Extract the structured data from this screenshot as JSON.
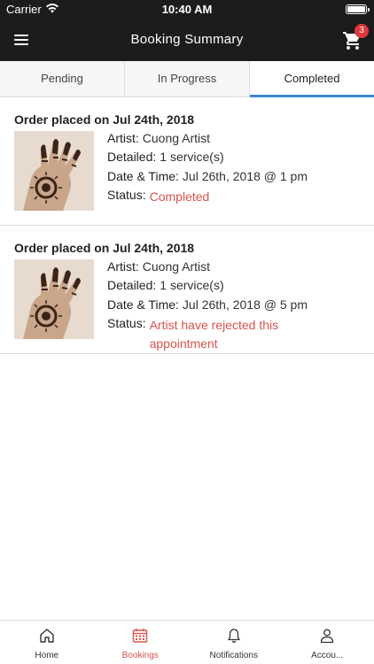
{
  "status_bar": {
    "carrier": "Carrier",
    "time": "10:40 AM"
  },
  "nav": {
    "title": "Booking Summary",
    "cart_count": "3"
  },
  "tabs": [
    {
      "label": "Pending",
      "active": false
    },
    {
      "label": "In Progress",
      "active": false
    },
    {
      "label": "Completed",
      "active": true
    }
  ],
  "orders": [
    {
      "heading": "Order placed on Jul 24th, 2018",
      "artist_label": "Artist:",
      "artist": "Cuong Artist",
      "detailed_label": "Detailed:",
      "detailed": "1 service(s)",
      "datetime_label": "Date & Time:",
      "datetime": "Jul 26th, 2018 @ 1 pm",
      "status_label": "Status:",
      "status": "Completed"
    },
    {
      "heading": "Order placed on Jul 24th, 2018",
      "artist_label": "Artist:",
      "artist": "Cuong Artist",
      "detailed_label": "Detailed:",
      "detailed": "1 service(s)",
      "datetime_label": "Date & Time:",
      "datetime": "Jul 26th, 2018 @ 5 pm",
      "status_label": "Status:",
      "status": "Artist have rejected this appointment"
    }
  ],
  "bottom_nav": [
    {
      "label": "Home",
      "icon": "home-icon",
      "active": false
    },
    {
      "label": "Bookings",
      "icon": "calendar-icon",
      "active": true
    },
    {
      "label": "Notifications",
      "icon": "bell-icon",
      "active": false
    },
    {
      "label": "Accou...",
      "icon": "user-icon",
      "active": false
    }
  ],
  "colors": {
    "accent_red": "#d9534f",
    "tab_indicator": "#3a87d6",
    "header_bg": "#1c1c1c",
    "badge": "#e0383e"
  }
}
